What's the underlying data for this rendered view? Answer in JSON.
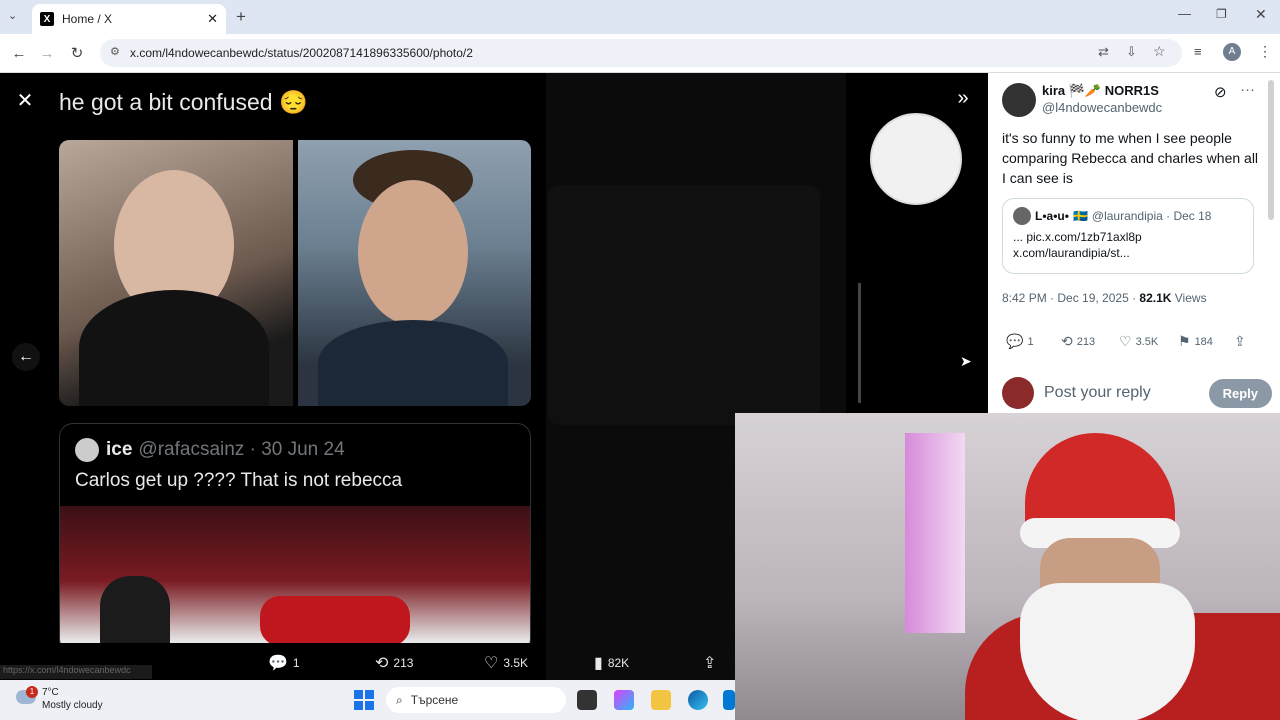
{
  "browser": {
    "tab_title": "Home / X",
    "new_tab": "+",
    "url": "x.com/l4ndowecanbewdc/status/2002087141896335600/photo/2",
    "status_url": "https://x.com/l4ndowecanbewdc"
  },
  "viewer": {
    "caption": "he got a bit confused 😔",
    "quote": {
      "name": "ice",
      "handle": "@rafacsainz · 30 Jun 24",
      "text": "Carlos get up ???? That is not rebecca"
    },
    "actions": {
      "replies": "1",
      "reposts": "213",
      "likes": "3.5K",
      "views": "82K"
    }
  },
  "tweet": {
    "display_name": "kira 🏁🥕 NORR1S",
    "handle": "@l4ndowecanbewdc",
    "text": "it's so funny to me when I see people comparing Rebecca and charles when all I can see is",
    "quoted": {
      "name": "L•a•u•",
      "flag": "🇸🇪",
      "handle": "@laurandipia · Dec 18",
      "line1": "... pic.x.com/1zb71axl8p",
      "line2": "x.com/laurandipia/st..."
    },
    "time": "8:42 PM · Dec 19, 2025 · ",
    "views_count": "82.1K",
    "views_label": " Views",
    "stats": {
      "replies": "1",
      "reposts": "213",
      "likes": "3.5K",
      "bookmarks": "184"
    },
    "reply_placeholder": "Post your reply",
    "reply_button": "Reply"
  },
  "taskbar": {
    "temperature": "7°C",
    "weather": "Mostly cloudy",
    "notification_count": "1",
    "search_placeholder": "Търсене"
  }
}
